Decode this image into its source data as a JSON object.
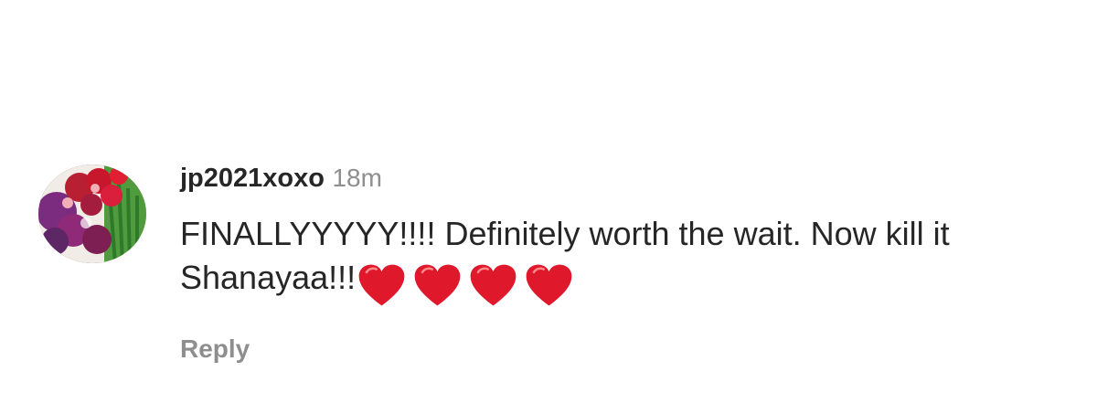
{
  "comment": {
    "username": "jp2021xoxo",
    "time": "18m",
    "text": "FINALLYYYYY!!!! Definitely worth the wait. Now kill it Shanayaa!!!",
    "emoji": [
      "red-heart",
      "red-heart",
      "red-heart",
      "red-heart"
    ],
    "reply_label": "Reply",
    "avatar_icon": "flower-bouquet-avatar"
  },
  "colors": {
    "text_primary": "#262626",
    "text_secondary": "#8e8e8e",
    "heart_red": "#e0182c",
    "background": "#ffffff"
  }
}
